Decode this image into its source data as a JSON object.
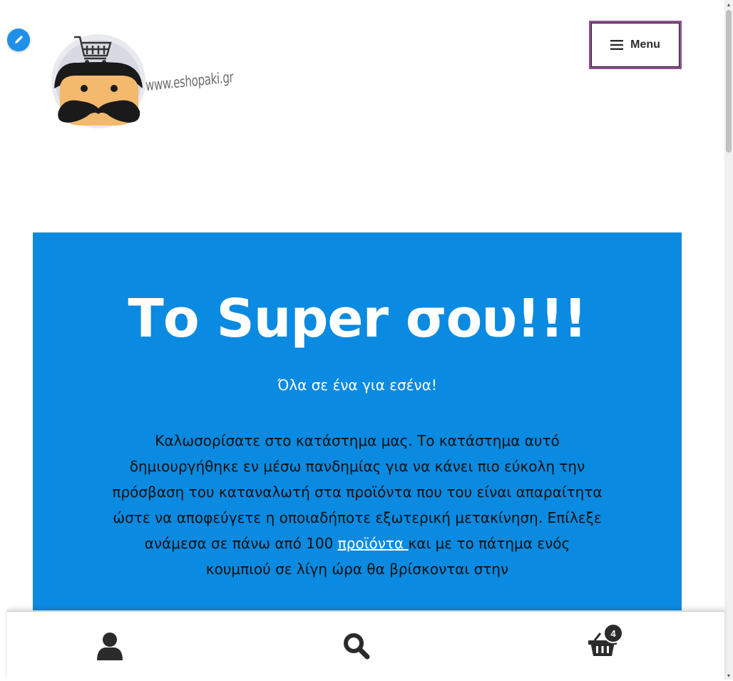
{
  "header": {
    "logo_text": "www.eshopaki.gr",
    "menu_label": "Menu",
    "menu_icon": "hamburger-icon",
    "edit_icon": "pencil-icon"
  },
  "hero": {
    "title": "Το Super σου!!!",
    "subtitle": "Όλα σε ένα για εσένα!",
    "paragraph_before_link": "Καλωσορίσατε στο κατάστημα μας. Το κατάστημα αυτό δημιουργήθηκε εν μέσω πανδημίας για να κάνει πιο εύκολη την πρόσβαση του καταναλωτή στα προϊόντα που του είναι απαραίτητα ώστε να αποφεύγετε η οποιαδήποτε εξωτερική μετακίνηση. Επίλεξε ανάμεσα σε πάνω από 100 ",
    "paragraph_link": "προϊόντα ",
    "paragraph_after_link": "και με το πάτημα ενός κουμπιού σε λίγη ώρα θα βρίσκονται στην",
    "background_color": "#0a8ae0"
  },
  "footer": {
    "account_icon": "user-icon",
    "search_icon": "search-icon",
    "cart_icon": "basket-icon",
    "cart_count": "4"
  }
}
